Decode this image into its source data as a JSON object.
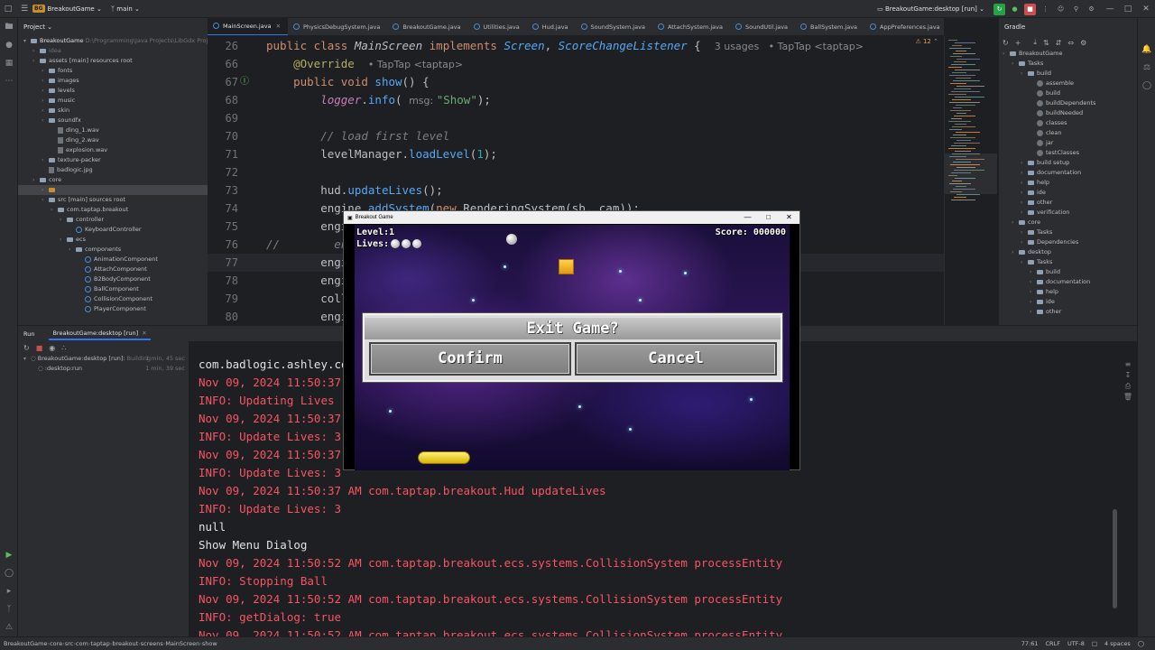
{
  "titlebar": {
    "project_badge": "BG",
    "project_name": "BreakoutGame",
    "branch": "main",
    "run_config": "BreakoutGame:desktop [run]"
  },
  "project_panel": {
    "title": "Project",
    "root_name": "BreakoutGame",
    "root_path": "D:\\Programming\\Java Projects\\LibGdx Project",
    "items": [
      {
        "label": "idea",
        "indent": 1,
        "kind": "folder-muted"
      },
      {
        "label": "assets [main]  resources root",
        "indent": 1,
        "kind": "folder"
      },
      {
        "label": "fonts",
        "indent": 2,
        "kind": "folder"
      },
      {
        "label": "images",
        "indent": 2,
        "kind": "folder"
      },
      {
        "label": "levels",
        "indent": 2,
        "kind": "folder"
      },
      {
        "label": "music",
        "indent": 2,
        "kind": "folder"
      },
      {
        "label": "skin",
        "indent": 2,
        "kind": "folder"
      },
      {
        "label": "soundfx",
        "indent": 2,
        "kind": "folder"
      },
      {
        "label": "ding_1.wav",
        "indent": 3,
        "kind": "file"
      },
      {
        "label": "ding_2.wav",
        "indent": 3,
        "kind": "file"
      },
      {
        "label": "explosion.wav",
        "indent": 3,
        "kind": "file"
      },
      {
        "label": "texture-packer",
        "indent": 2,
        "kind": "folder"
      },
      {
        "label": "badlogic.jpg",
        "indent": 2,
        "kind": "file"
      },
      {
        "label": "core",
        "indent": 1,
        "kind": "folder"
      },
      {
        "label": "",
        "indent": 2,
        "kind": "folder-orange"
      },
      {
        "label": "src [main]  sources root",
        "indent": 2,
        "kind": "folder"
      },
      {
        "label": "com.taptap.breakout",
        "indent": 3,
        "kind": "folder"
      },
      {
        "label": "controller",
        "indent": 4,
        "kind": "folder"
      },
      {
        "label": "KeyboardController",
        "indent": 5,
        "kind": "class"
      },
      {
        "label": "ecs",
        "indent": 4,
        "kind": "folder"
      },
      {
        "label": "components",
        "indent": 5,
        "kind": "folder"
      },
      {
        "label": "AnimationComponent",
        "indent": 6,
        "kind": "class"
      },
      {
        "label": "AttachComponent",
        "indent": 6,
        "kind": "class"
      },
      {
        "label": "B2BodyComponent",
        "indent": 6,
        "kind": "class"
      },
      {
        "label": "BallComponent",
        "indent": 6,
        "kind": "class"
      },
      {
        "label": "CollisionComponent",
        "indent": 6,
        "kind": "class"
      },
      {
        "label": "PlayerComponent",
        "indent": 6,
        "kind": "class"
      }
    ]
  },
  "tabs": [
    {
      "label": "MainScreen.java",
      "active": true
    },
    {
      "label": "PhysicsDebugSystem.java",
      "active": false
    },
    {
      "label": "BreakoutGame.java",
      "active": false
    },
    {
      "label": "Utilities.java",
      "active": false
    },
    {
      "label": "Hud.java",
      "active": false
    },
    {
      "label": "SoundSystem.java",
      "active": false
    },
    {
      "label": "AttachSystem.java",
      "active": false
    },
    {
      "label": "SoundUtil.java",
      "active": false
    },
    {
      "label": "BallSystem.java",
      "active": false
    },
    {
      "label": "AppPreferences.java",
      "active": false
    }
  ],
  "editor": {
    "inspection_count": "12",
    "lines": [
      {
        "num": "26",
        "tokens": [
          {
            "t": "public class ",
            "c": "kw"
          },
          {
            "t": "MainScreen ",
            "c": "it2"
          },
          {
            "t": "implements ",
            "c": "kw"
          },
          {
            "t": "Screen",
            "c": "iface"
          },
          {
            "t": ", ",
            "c": "id"
          },
          {
            "t": "ScoreChangeListener",
            "c": "iface"
          },
          {
            "t": " {  ",
            "c": "id"
          },
          {
            "t": "3 usages   • TapTap <taptap>",
            "c": "hint"
          }
        ]
      },
      {
        "num": "66",
        "tokens": [
          {
            "t": "    @Override  ",
            "c": "ann"
          },
          {
            "t": "• TapTap <taptap>",
            "c": "hint"
          }
        ]
      },
      {
        "num": "67",
        "tokens": [
          {
            "t": "    public void ",
            "c": "kw"
          },
          {
            "t": "show",
            "c": "fn"
          },
          {
            "t": "() {",
            "c": "id"
          }
        ]
      },
      {
        "num": "68",
        "tokens": [
          {
            "t": "        logger",
            "c": "it"
          },
          {
            "t": ".",
            "c": "id"
          },
          {
            "t": "info",
            "c": "fn"
          },
          {
            "t": "( ",
            "c": "id"
          },
          {
            "t": "msg: ",
            "c": "hint"
          },
          {
            "t": "\"Show\"",
            "c": "str"
          },
          {
            "t": ");",
            "c": "id"
          }
        ]
      },
      {
        "num": "69",
        "tokens": []
      },
      {
        "num": "70",
        "tokens": [
          {
            "t": "        // load first level",
            "c": "cm"
          }
        ]
      },
      {
        "num": "71",
        "tokens": [
          {
            "t": "        levelManager.",
            "c": "id"
          },
          {
            "t": "loadLevel",
            "c": "fn"
          },
          {
            "t": "(",
            "c": "id"
          },
          {
            "t": "1",
            "c": "num"
          },
          {
            "t": ");",
            "c": "id"
          }
        ]
      },
      {
        "num": "72",
        "tokens": []
      },
      {
        "num": "73",
        "tokens": [
          {
            "t": "        hud.",
            "c": "id"
          },
          {
            "t": "updateLives",
            "c": "fn"
          },
          {
            "t": "();",
            "c": "id"
          }
        ]
      },
      {
        "num": "74",
        "tokens": [
          {
            "t": "        engine.",
            "c": "id"
          },
          {
            "t": "addSystem",
            "c": "fn"
          },
          {
            "t": "(",
            "c": "id"
          },
          {
            "t": "new ",
            "c": "kw"
          },
          {
            "t": "RenderingSystem",
            "c": "id"
          },
          {
            "t": "(sb, cam));",
            "c": "id"
          }
        ]
      },
      {
        "num": "75",
        "tokens": [
          {
            "t": "        engi",
            "c": "id"
          }
        ]
      },
      {
        "num": "76",
        "tokens": [
          {
            "t": "//        en",
            "c": "cm"
          }
        ]
      },
      {
        "num": "77",
        "tokens": [
          {
            "t": "        engi",
            "c": "id"
          }
        ]
      },
      {
        "num": "78",
        "tokens": [
          {
            "t": "        engi",
            "c": "id"
          }
        ]
      },
      {
        "num": "79",
        "tokens": [
          {
            "t": "        coll",
            "c": "id"
          },
          {
            "t": "                                                    is",
            "c": "it"
          },
          {
            "t": ");",
            "c": "id"
          }
        ]
      },
      {
        "num": "80",
        "tokens": [
          {
            "t": "        engi",
            "c": "id"
          }
        ]
      }
    ]
  },
  "gradle_panel": {
    "title": "Gradle",
    "items": [
      {
        "label": "BreakoutGame",
        "indent": 0
      },
      {
        "label": "Tasks",
        "indent": 1
      },
      {
        "label": "build",
        "indent": 2
      },
      {
        "label": "assemble",
        "indent": 3
      },
      {
        "label": "build",
        "indent": 3
      },
      {
        "label": "buildDependents",
        "indent": 3
      },
      {
        "label": "buildNeeded",
        "indent": 3
      },
      {
        "label": "classes",
        "indent": 3
      },
      {
        "label": "clean",
        "indent": 3
      },
      {
        "label": "jar",
        "indent": 3
      },
      {
        "label": "testClasses",
        "indent": 3
      },
      {
        "label": "build setup",
        "indent": 2
      },
      {
        "label": "documentation",
        "indent": 2
      },
      {
        "label": "help",
        "indent": 2
      },
      {
        "label": "ide",
        "indent": 2
      },
      {
        "label": "other",
        "indent": 2
      },
      {
        "label": "verification",
        "indent": 2
      },
      {
        "label": "core",
        "indent": 1
      },
      {
        "label": "Tasks",
        "indent": 2
      },
      {
        "label": "Dependencies",
        "indent": 2
      },
      {
        "label": "desktop",
        "indent": 1
      },
      {
        "label": "Tasks",
        "indent": 2
      },
      {
        "label": "build",
        "indent": 3
      },
      {
        "label": "documentation",
        "indent": 3
      },
      {
        "label": "help",
        "indent": 3
      },
      {
        "label": "ide",
        "indent": 3
      },
      {
        "label": "other",
        "indent": 3
      }
    ]
  },
  "run_panel": {
    "tab_run": "Run",
    "tab_config": "BreakoutGame:desktop [run]",
    "tree": [
      {
        "label": "BreakoutGame:desktop [run]:",
        "status": "Building",
        "time": "1 min, 45 sec"
      },
      {
        "label": ":desktop:run",
        "time": "1 min, 39 sec"
      }
    ]
  },
  "console": {
    "lines": [
      {
        "text": "com.badlogic.ashley.cor",
        "c": "white"
      },
      {
        "text": "Nov 09, 2024 11:50:37 A",
        "c": "red"
      },
      {
        "text": "INFO: Updating Lives",
        "c": "red"
      },
      {
        "text": "Nov 09, 2024 11:50:37 A",
        "c": "red"
      },
      {
        "text": "INFO: Update Lives: 3",
        "c": "red"
      },
      {
        "text": "Nov 09, 2024 11:50:37 A",
        "c": "red"
      },
      {
        "text": "INFO: Update Lives: 3",
        "c": "red"
      },
      {
        "text": "Nov 09, 2024 11:50:37 AM com.taptap.breakout.Hud updateLives",
        "c": "red"
      },
      {
        "text": "INFO: Update Lives: 3",
        "c": "red"
      },
      {
        "text": "null",
        "c": "white"
      },
      {
        "text": "Show Menu Dialog",
        "c": "white"
      },
      {
        "text": "Nov 09, 2024 11:50:52 AM com.taptap.breakout.ecs.systems.CollisionSystem processEntity",
        "c": "red"
      },
      {
        "text": "INFO: Stopping Ball",
        "c": "red"
      },
      {
        "text": "Nov 09, 2024 11:50:52 AM com.taptap.breakout.ecs.systems.CollisionSystem processEntity",
        "c": "red"
      },
      {
        "text": "INFO: getDialog: true",
        "c": "red"
      },
      {
        "text": "Nov 09, 2024 11:50:52 AM com.taptap.breakout.ecs.systems.CollisionSystem processEntity",
        "c": "red"
      }
    ]
  },
  "statusbar": {
    "breadcrumbs": [
      "BreakoutGame",
      "core",
      "src",
      "com",
      "taptap",
      "breakout",
      "screens",
      "MainScreen",
      "show"
    ],
    "position": "77:61",
    "line_sep": "CRLF",
    "encoding": "UTF-8",
    "indent": "4 spaces"
  },
  "game_window": {
    "title": "Breakout Game",
    "level_label": "Level:1",
    "lives_label": "Lives:",
    "lives": 3,
    "score_label": "Score: 000000",
    "dialog": {
      "title": "Exit Game?",
      "confirm": "Confirm",
      "cancel": "Cancel"
    }
  },
  "colors": {
    "ide_bg": "#1e1f22",
    "panel_bg": "#2b2d30",
    "accent": "#3574f0",
    "run_green": "#27a046",
    "stop_red": "#c94f4f",
    "log_red": "#f75464"
  }
}
